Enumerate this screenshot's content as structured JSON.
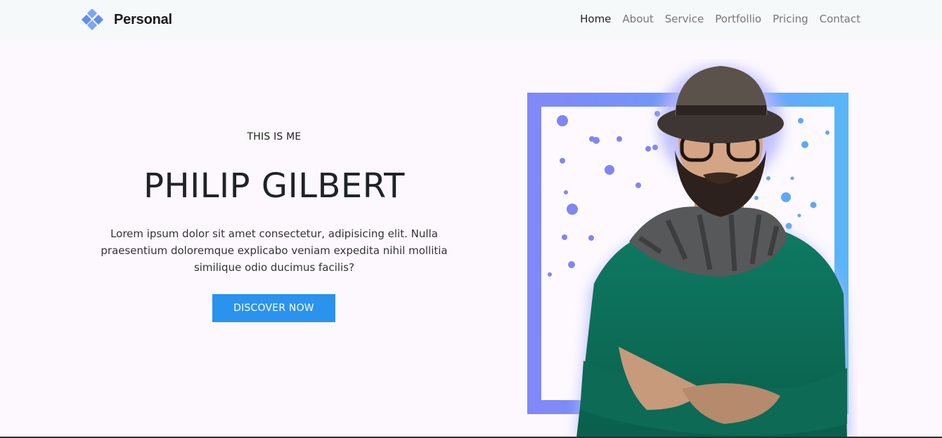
{
  "brand": {
    "name": "Personal"
  },
  "nav": {
    "items": [
      "Home",
      "About",
      "Service",
      "Portfollio",
      "Pricing",
      "Contact"
    ],
    "active": "Home"
  },
  "hero": {
    "kicker": "THIS IS ME",
    "name": "PHILIP GILBERT",
    "description": "Lorem ipsum dolor sit amet consectetur, adipisicing elit. Nulla praesentium doloremque explicabo veniam expedita nihil mollitia similique odio ducimus facilis?",
    "button": "DISCOVER NOW"
  },
  "colors": {
    "accent": "#2a93ee",
    "frame_start": "#8088f7",
    "frame_end": "#58b7f8",
    "sweater": "#0f6e5a"
  },
  "icons": {
    "logo": "diamond-cluster-icon"
  }
}
